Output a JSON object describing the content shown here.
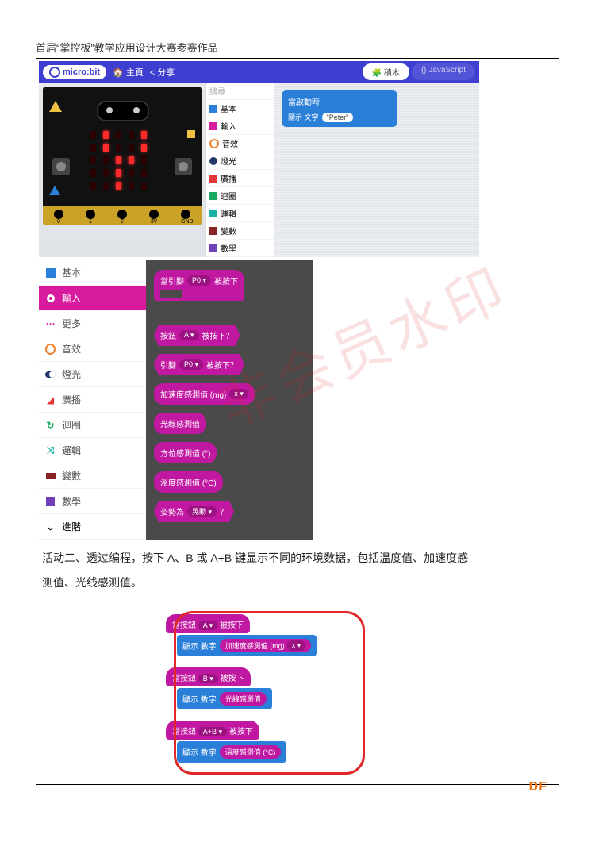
{
  "header": "首届“掌控板”教学应用设计大赛参赛作品",
  "watermark": "非会员水印",
  "footer": "DF",
  "editor": {
    "brand": "micro:bit",
    "nav_home": "主頁",
    "nav_share": "分享",
    "tab_blocks": "積木",
    "tab_js": "{} JavaScript",
    "search_placeholder": "搜尋...",
    "start_block": "當啟動時",
    "show_label": "顯示 文字",
    "show_value": "\"Peter\"",
    "pins": [
      "0",
      "1",
      "2",
      "3V",
      "GND"
    ]
  },
  "categories_compact": [
    {
      "label": "基本",
      "cls": "cat-blue"
    },
    {
      "label": "輸入",
      "cls": "cat-pink"
    },
    {
      "label": "音效",
      "cls": "cat-orangeO"
    },
    {
      "label": "燈光",
      "cls": "cat-darkblue"
    },
    {
      "label": "廣播",
      "cls": "cat-red"
    },
    {
      "label": "迴圈",
      "cls": "cat-green"
    },
    {
      "label": "邏輯",
      "cls": "cat-teal"
    },
    {
      "label": "變數",
      "cls": "cat-darkred"
    },
    {
      "label": "數學",
      "cls": "cat-purple"
    }
  ],
  "categories_full": [
    {
      "label": "基本",
      "icon": "grid",
      "color": "#2a7fd8"
    },
    {
      "label": "輸入",
      "icon": "dot",
      "color": "#d81b9e",
      "selected": true
    },
    {
      "label": "更多",
      "icon": "more",
      "color": "#d81b9e"
    },
    {
      "label": "音效",
      "icon": "head",
      "color": "#f08030"
    },
    {
      "label": "燈光",
      "icon": "toggle",
      "color": "#22386b"
    },
    {
      "label": "廣播",
      "icon": "sig",
      "color": "#e23838"
    },
    {
      "label": "迴圈",
      "icon": "arrow",
      "color": "#1aa861"
    },
    {
      "label": "邏輯",
      "icon": "shuf",
      "color": "#18b0a8"
    },
    {
      "label": "變數",
      "icon": "var",
      "color": "#8a2424"
    },
    {
      "label": "數學",
      "icon": "calc",
      "color": "#6f3fb8"
    },
    {
      "label": "進階",
      "icon": "down",
      "color": "#000"
    }
  ],
  "input_flyout": {
    "pin_pressed": {
      "prefix": "當引腳",
      "pin": "P0 ▾",
      "suffix": "被按下"
    },
    "button_pressed_q": {
      "prefix": "按鈕",
      "btn": "A ▾",
      "suffix": "被按下？"
    },
    "pin_pressed_q": {
      "prefix": "引腳",
      "pin": "P0 ▾",
      "suffix": "被按下？"
    },
    "accel": {
      "prefix": "加速度感測值 (mg)",
      "axis": "x ▾"
    },
    "light": "光線感測值",
    "compass": "方位感測值 (°)",
    "temp": "溫度感測值 (°C)",
    "gesture": {
      "prefix": "姿勢為",
      "val": "晃動 ▾",
      "suffix": "？"
    }
  },
  "body_text_1": "活动二、透过编程，按下 A、B 或 A+B 键显示不同的环境数据，包括温度值、加速度感测值、光线感测值。",
  "activity2": {
    "b1": {
      "hat_prefix": "當按鈕",
      "hat_btn": "A ▾",
      "hat_suffix": "被按下",
      "show": "顯示 數字",
      "val_prefix": "加速度感測值 (mg)",
      "val_axis": "x ▾"
    },
    "b2": {
      "hat_prefix": "當按鈕",
      "hat_btn": "B ▾",
      "hat_suffix": "被按下",
      "show": "顯示 數字",
      "val": "光線感測值"
    },
    "b3": {
      "hat_prefix": "當按鈕",
      "hat_btn": "A+B ▾",
      "hat_suffix": "被按下",
      "show": "顯示 數字",
      "val": "溫度感測值 (°C)"
    }
  },
  "led_on": [
    1,
    4,
    6,
    9,
    12,
    13,
    17,
    22
  ]
}
